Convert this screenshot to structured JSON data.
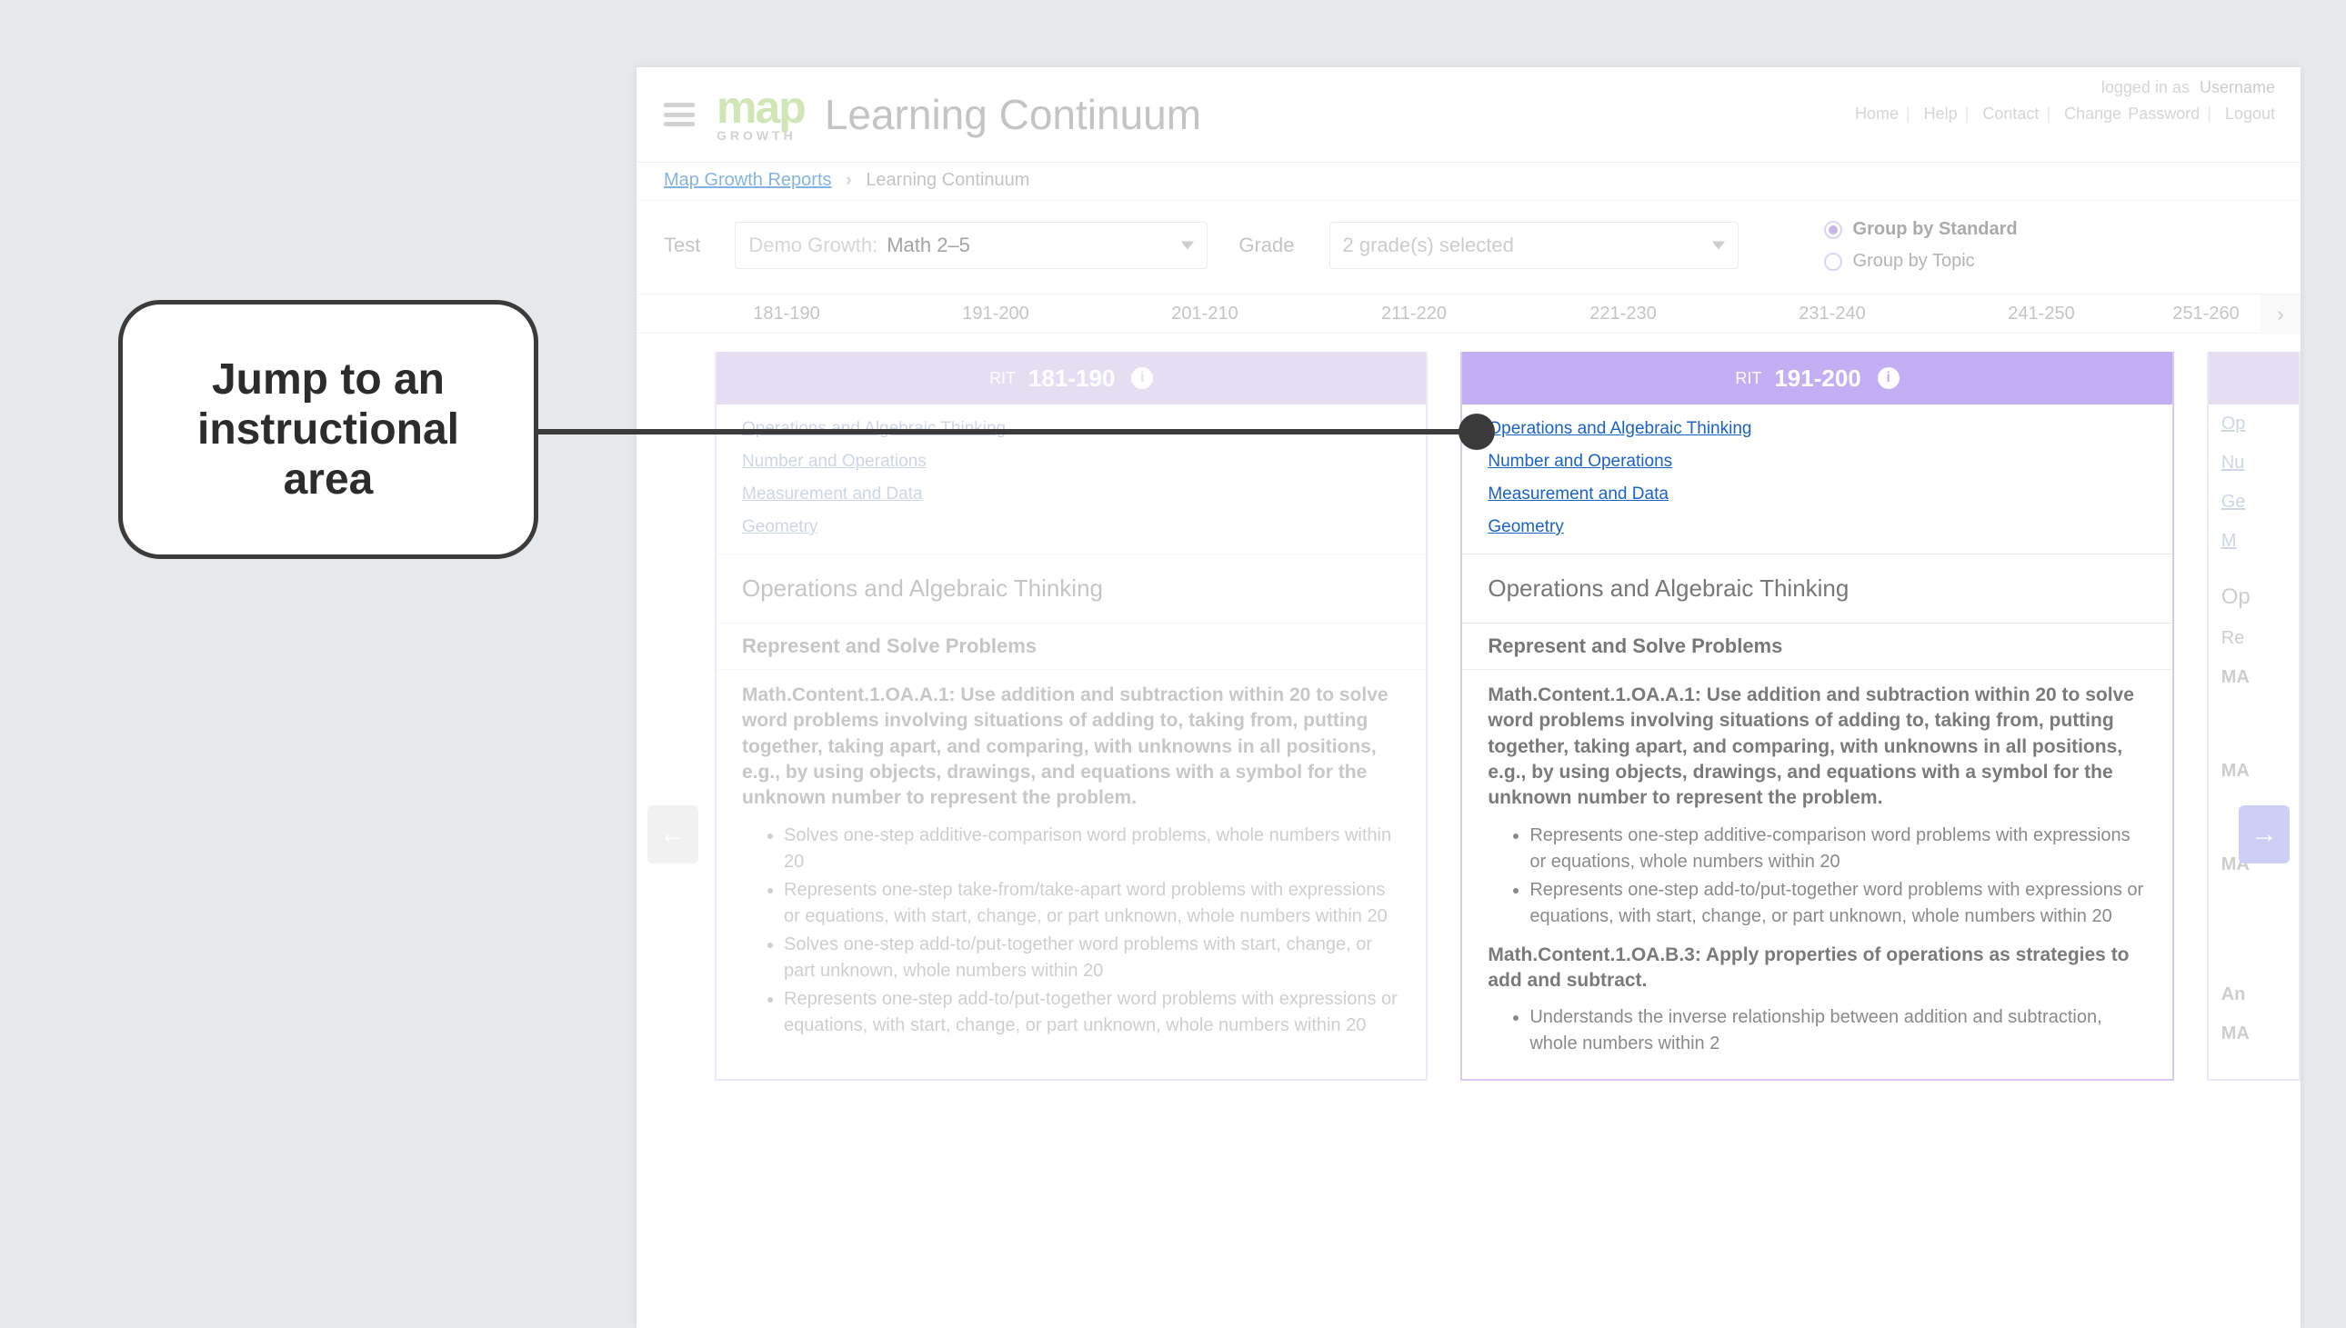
{
  "header": {
    "logo_main": "map",
    "logo_sub": "GROWTH",
    "page_title": "Learning Continuum",
    "logged_in_prefix": "logged in as",
    "username": "Username",
    "links": [
      "Home",
      "Help",
      "Contact",
      "Change Password",
      "Logout"
    ]
  },
  "breadcrumb": {
    "root": "Map Growth Reports",
    "current": "Learning Continuum"
  },
  "filters": {
    "test_label": "Test",
    "test_prefix": "Demo Growth:",
    "test_value": "Math 2–5",
    "grade_label": "Grade",
    "grade_value": "2 grade(s) selected",
    "grouping": {
      "by_standard": "Group by Standard",
      "by_topic": "Group by Topic",
      "selected": "by_standard"
    }
  },
  "rit_tabs": [
    "181-190",
    "191-200",
    "201-210",
    "211-220",
    "221-230",
    "231-240",
    "241-250",
    "251-260"
  ],
  "columns": [
    {
      "rit_prefix": "RIT",
      "rit_range": "181-190",
      "jump_links": [
        "Operations and Algebraic Thinking",
        "Number and Operations",
        "Measurement and Data",
        "Geometry"
      ],
      "section_title": "Operations and Algebraic Thinking",
      "subsection_title": "Represent and Solve Problems",
      "standards": [
        {
          "code": "Math.Content.1.OA.A.1: Use addition and subtraction within 20 to solve word problems involving situations of adding to, taking from, putting together, taking apart, and comparing, with unknowns in all positions, e.g., by using objects, drawings, and equations with a symbol for the unknown number to represent the problem.",
          "bullets": [
            "Solves one-step additive-comparison word problems, whole numbers within 20",
            "Represents one-step take-from/take-apart word problems with expressions or equations, with start, change, or part unknown, whole numbers within 20",
            "Solves one-step add-to/put-together word problems with start, change, or part unknown, whole numbers within 20",
            "Represents one-step add-to/put-together word problems with expressions or equations, with start, change, or part unknown, whole numbers within 20"
          ]
        }
      ]
    },
    {
      "rit_prefix": "RIT",
      "rit_range": "191-200",
      "jump_links": [
        "Operations and Algebraic Thinking",
        "Number and Operations",
        "Measurement and Data",
        "Geometry"
      ],
      "section_title": "Operations and Algebraic Thinking",
      "subsection_title": "Represent and Solve Problems",
      "standards": [
        {
          "code": "Math.Content.1.OA.A.1: Use addition and subtraction within 20 to solve word problems involving situations of adding to, taking from, putting together, taking apart, and comparing, with unknowns in all positions, e.g., by using objects, drawings, and equations with a symbol for the unknown number to represent the problem.",
          "bullets": [
            "Represents one-step additive-comparison word problems with expressions or equations, whole numbers within 20",
            "Represents one-step add-to/put-together word problems with expressions or equations, with start, change, or part unknown, whole numbers within 20"
          ]
        },
        {
          "code": "Math.Content.1.OA.B.3: Apply properties of operations as strategies to add and subtract.",
          "bullets": [
            "Understands the inverse relationship between addition and subtraction, whole numbers within 2"
          ]
        }
      ]
    }
  ],
  "callout": "Jump to an instructional area"
}
